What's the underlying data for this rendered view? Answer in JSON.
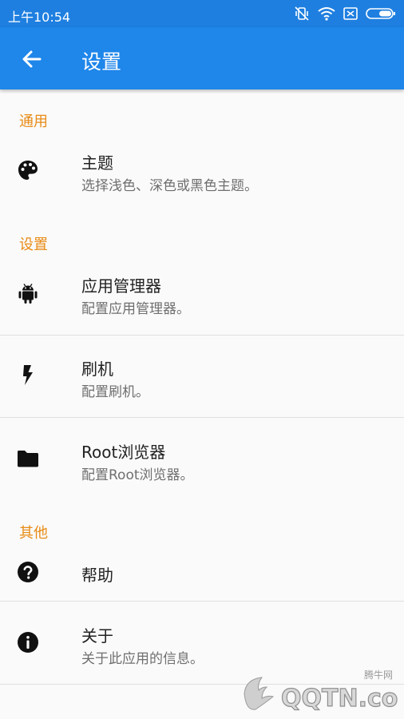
{
  "status_bar": {
    "time": "上午10:54"
  },
  "app_bar": {
    "title": "设置"
  },
  "sections": {
    "general": "通用",
    "settings": "设置",
    "other": "其他"
  },
  "items": {
    "theme": {
      "title": "主题",
      "subtitle": "选择浅色、深色或黑色主题。"
    },
    "app_manager": {
      "title": "应用管理器",
      "subtitle": "配置应用管理器。"
    },
    "flash": {
      "title": "刷机",
      "subtitle": "配置刷机。"
    },
    "root_browser": {
      "title": "Root浏览器",
      "subtitle": "配置Root浏览器。"
    },
    "help": {
      "title": "帮助"
    },
    "about": {
      "title": "关于",
      "subtitle": "关于此应用的信息。"
    }
  },
  "watermark": {
    "site_cn": "腾牛网",
    "logo_text": "QQTN.com"
  }
}
